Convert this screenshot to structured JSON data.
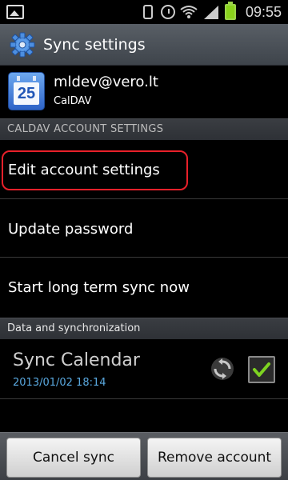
{
  "status_bar": {
    "time": "09:55",
    "icons": [
      "image-icon",
      "vibrate-icon",
      "alarm-icon",
      "wifi-icon",
      "signal-icon",
      "battery-icon"
    ]
  },
  "title_bar": {
    "title": "Sync settings",
    "icon": "gear-icon"
  },
  "account": {
    "email": "mldev@vero.lt",
    "type": "CalDAV",
    "calendar_day": "25"
  },
  "sections": {
    "caldav_header": "CALDAV ACCOUNT SETTINGS",
    "data_header": "Data and synchronization"
  },
  "menu": {
    "items": [
      {
        "label": "Edit account settings"
      },
      {
        "label": "Update password"
      },
      {
        "label": "Start long term sync now"
      }
    ]
  },
  "sync_calendar": {
    "title": "Sync Calendar",
    "last_sync": "2013/01/02 18:14",
    "checked": true
  },
  "buttons": {
    "cancel_sync": "Cancel sync",
    "remove_account": "Remove account"
  },
  "colors": {
    "highlight": "#e8202a",
    "timestamp": "#5aa9e0",
    "check": "#7ed321"
  }
}
